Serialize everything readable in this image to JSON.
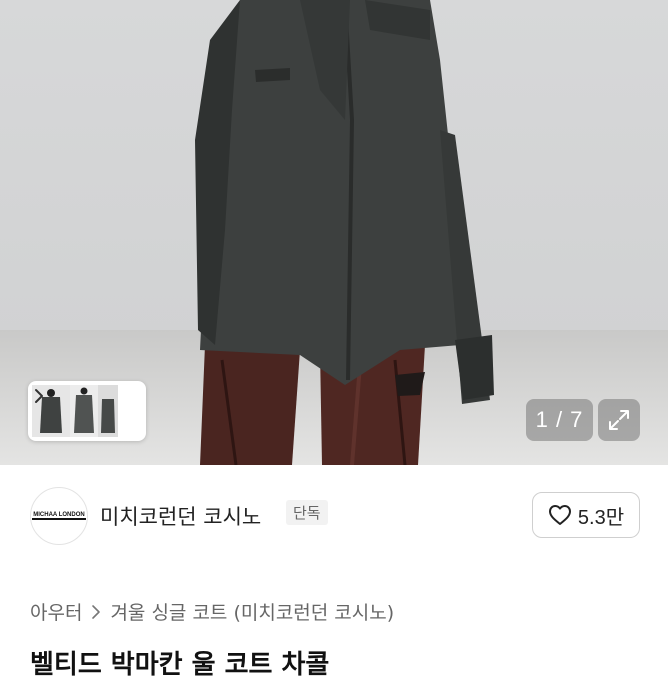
{
  "gallery": {
    "counter": "1 / 7",
    "icons": {
      "zoom": "expand-icon",
      "thumbs_next": "chevron-right-icon"
    }
  },
  "store": {
    "logo_text": "MICHAA LONDON",
    "name": "미치코런던 코시노",
    "badge": "단독",
    "like_icon": "heart-outline-icon",
    "like_count": "5.3만"
  },
  "breadcrumb": {
    "items": [
      "아우터",
      "겨울 싱글 코트 (미치코런던 코시노)"
    ],
    "separator_icon": "chevron-right-icon"
  },
  "product": {
    "title": "벨티드 박마칸 울 코트 차콜"
  },
  "colors": {
    "coat": "#3d403f",
    "pants": "#4a2520",
    "background": "#d5d6d7"
  }
}
